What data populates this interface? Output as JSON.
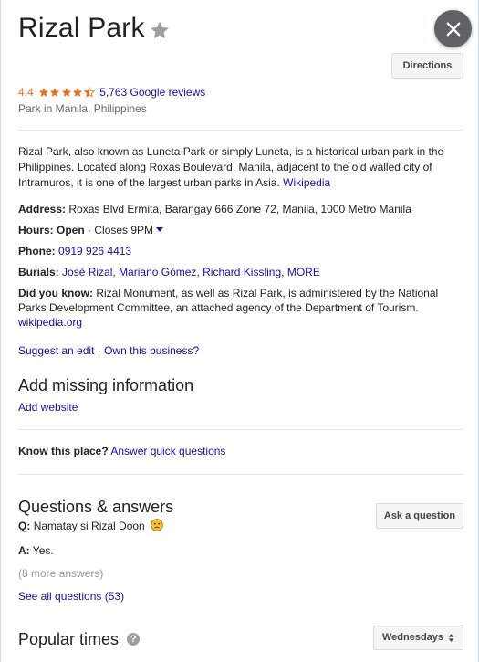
{
  "place": {
    "title": "Rizal Park",
    "rating": "4.4",
    "rating_value": 4.4,
    "reviews": "5,763 Google reviews",
    "category": "Park in Manila, Philippines"
  },
  "actions": {
    "directions": "Directions",
    "ask_question": "Ask a question",
    "day_select": "Wednesdays"
  },
  "description": {
    "text": "Rizal Park, also known as Luneta Park or simply Luneta, is a historical urban park in the Philippines. Located along Roxas Boulevard, Manila, adjacent to the old walled city of Intramuros, it is one of the largest urban parks in Asia.",
    "source": "Wikipedia"
  },
  "details": {
    "address_label": "Address:",
    "address": "Roxas Blvd Ermita, Barangay 666 Zone 72, Manila, 1000 Metro Manila",
    "hours_label": "Hours:",
    "hours_status": "Open",
    "hours_sep": " · ",
    "hours_close": "Closes 9PM",
    "phone_label": "Phone:",
    "phone": "0919 926 4413",
    "burials_label": "Burials:",
    "burials": [
      "José Rizal",
      "Mariano Gómez",
      "Richard Kissling",
      "MORE"
    ],
    "didyouknow_label": "Did you know:",
    "didyouknow": "Rizal Monument, as well as Rizal Park, is administered by the National Parks Development Committee, an attached agency of the Department of Tourism.",
    "didyouknow_source": "wikipedia.org"
  },
  "edit": {
    "suggest": "Suggest an edit",
    "sep": " · ",
    "own": "Own this business?"
  },
  "missing": {
    "heading": "Add missing information",
    "add_website": "Add website"
  },
  "know": {
    "label": "Know this place?",
    "link": "Answer quick questions"
  },
  "qa": {
    "heading": "Questions & answers",
    "q_label": "Q:",
    "question": "Namatay si Rizal Doon",
    "a_label": "A:",
    "answer": "Yes.",
    "more": "(8 more answers)",
    "see_all": "See all questions (53)"
  },
  "popular": {
    "heading": "Popular times"
  },
  "colors": {
    "link": "#1a0dab",
    "rating": "#e7711b",
    "close_bg": "#5f6368"
  }
}
